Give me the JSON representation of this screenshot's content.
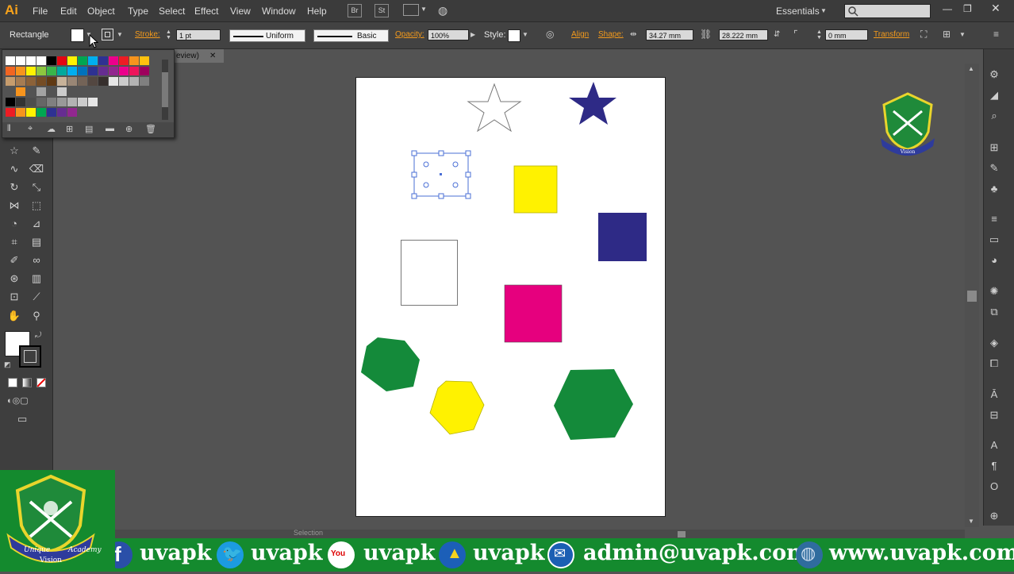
{
  "app": {
    "logo_text": "Ai"
  },
  "menu": [
    "File",
    "Edit",
    "Object",
    "Type",
    "Select",
    "Effect",
    "View",
    "Window",
    "Help"
  ],
  "topbar": {
    "br_label": "Br",
    "st_label": "St",
    "workspace": "Essentials"
  },
  "control_bar": {
    "tool_name": "Rectangle",
    "stroke_label": "Stroke:",
    "stroke_weight": "1 pt",
    "profile": "Uniform",
    "brush": "Basic",
    "opacity_label": "Opacity:",
    "opacity_value": "100%",
    "style_label": "Style:",
    "align_link": "Align",
    "shape_link": "Shape:",
    "width_value": "34.27 mm",
    "height_value": "28.222 mm",
    "corner_value": "0 mm",
    "transform_link": "Transform"
  },
  "document_tab": {
    "label": "eview)"
  },
  "status_bar": {
    "mode": "Selection"
  },
  "colors": {
    "yellow": "#fff200",
    "navy": "#2e2a86",
    "magenta": "#e6007e",
    "green": "#148a3a",
    "accent": "#f39a1c",
    "selection": "#4a6fd6"
  },
  "artboard_shapes": [
    {
      "name": "outline-star",
      "fill": "#ffffff"
    },
    {
      "name": "navy-star",
      "fill": "#2e2a86"
    },
    {
      "name": "selected-rectangle",
      "fill": "#ffffff"
    },
    {
      "name": "yellow-square",
      "fill": "#fff200"
    },
    {
      "name": "navy-square",
      "fill": "#2e2a86"
    },
    {
      "name": "white-rectangle",
      "fill": "#ffffff"
    },
    {
      "name": "magenta-square",
      "fill": "#e6007e"
    },
    {
      "name": "green-hexagon-small",
      "fill": "#148a3a"
    },
    {
      "name": "yellow-hexagon",
      "fill": "#fff200"
    },
    {
      "name": "green-hexagon-large",
      "fill": "#148a3a"
    }
  ],
  "watermark": {
    "logo_line1": "Unique",
    "logo_line2": "Vision",
    "logo_line3": "Academy"
  },
  "footer": {
    "facebook": "uvapk",
    "twitter": "uvapk",
    "youtube_icon": "You",
    "youtube": "uvapk",
    "other": "uvapk",
    "email": "admin@uvapk.com",
    "website": "www.uvapk.com"
  },
  "icons": [
    "search-icon",
    "minimize-icon",
    "maximize-icon",
    "close-icon",
    "facebook-icon",
    "twitter-icon",
    "youtube-icon",
    "email-icon",
    "globe-icon"
  ]
}
